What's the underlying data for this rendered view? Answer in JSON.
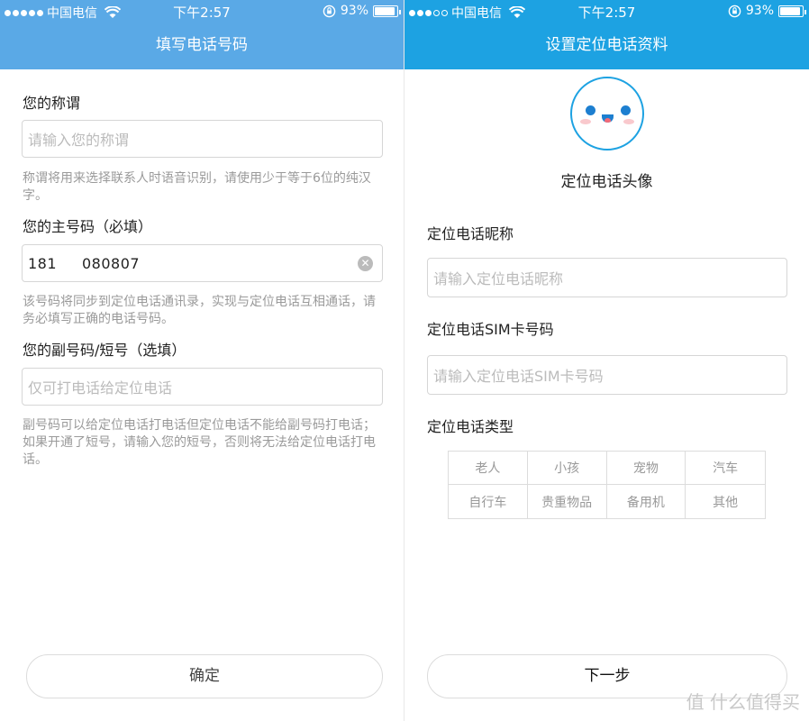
{
  "status_bar": {
    "carrier": "中国电信",
    "time": "下午2:57",
    "battery": "93%",
    "battery_fraction": 0.93
  },
  "left": {
    "title": "填写电话号码",
    "nickname": {
      "label": "您的称谓",
      "placeholder": "请输入您的称谓",
      "hint": "称谓将用来选择联系人时语音识别，请使用少于等于6位的纯汉字。"
    },
    "main_number": {
      "label": "您的主号码（必填）",
      "value": "181     080807",
      "hint": "该号码将同步到定位电话通讯录，实现与定位电话互相通话，请务必填写正确的电话号码。"
    },
    "sub_number": {
      "label": "您的副号码/短号（选填）",
      "placeholder": "仅可打电话给定位电话",
      "hint": "副号码可以给定位电话打电话但定位电话不能给副号码打电话；如果开通了短号，请输入您的短号，否则将无法给定位电话打电话。"
    },
    "confirm_label": "确定"
  },
  "right": {
    "title": "设置定位电话资料",
    "avatar_label": "定位电话头像",
    "nickname": {
      "label": "定位电话昵称",
      "placeholder": "请输入定位电话昵称"
    },
    "sim": {
      "label": "定位电话SIM卡号码",
      "placeholder": "请输入定位电话SIM卡号码"
    },
    "type": {
      "label": "定位电话类型",
      "options": [
        "老人",
        "小孩",
        "宠物",
        "汽车",
        "自行车",
        "贵重物品",
        "备用机",
        "其他"
      ]
    },
    "next_label": "下一步"
  },
  "watermark": "值 什么值得买"
}
